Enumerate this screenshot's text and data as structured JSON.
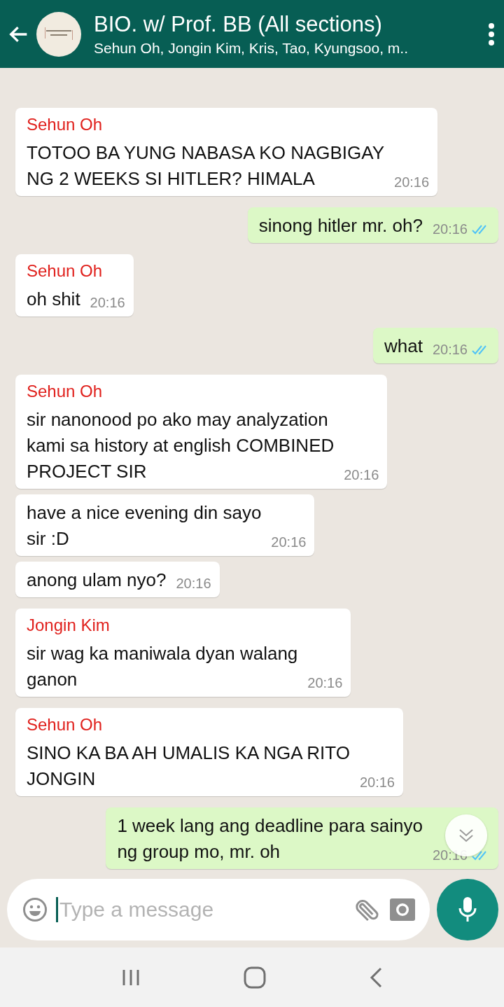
{
  "header": {
    "title": "BIO. w/ Prof. BB (All sections)",
    "subtitle": "Sehun Oh, Jongin Kim, Kris, Tao, Kyungsoo, m.."
  },
  "messages": [
    {
      "kind": "received",
      "sender": "Sehun Oh",
      "text": "TOTOO BA YUNG NABASA KO NAGBIGAY\nNG 2 WEEKS SI HITLER? HIMALA",
      "time": "20:16"
    },
    {
      "kind": "sent",
      "text": "sinong hitler mr. oh?",
      "time": "20:16",
      "read": true
    },
    {
      "kind": "received",
      "sender": "Sehun Oh",
      "text": "oh shit",
      "time": "20:16"
    },
    {
      "kind": "sent",
      "text": "what",
      "time": "20:16",
      "read": true
    },
    {
      "kind": "received",
      "sender": "Sehun Oh",
      "text": "sir nanonood po ako may analyzation\nkami sa history at english COMBINED\nPROJECT SIR",
      "time": "20:16"
    },
    {
      "kind": "received",
      "text": "have a nice evening din sayo\nsir :D",
      "time": "20:16"
    },
    {
      "kind": "received",
      "text": "anong ulam nyo?",
      "time": "20:16"
    },
    {
      "kind": "received",
      "sender": "Jongin Kim",
      "text": "sir wag ka maniwala dyan walang\nganon",
      "time": "20:16"
    },
    {
      "kind": "received",
      "sender": "Sehun Oh",
      "text": "SINO KA BA AH UMALIS KA NGA RITO\nJONGIN",
      "time": "20:16"
    },
    {
      "kind": "sent",
      "text": "1 week lang ang deadline para sainyo\nng group mo, mr. oh",
      "time": "20:16",
      "read": true
    }
  ],
  "composer": {
    "placeholder": "Type a message"
  }
}
